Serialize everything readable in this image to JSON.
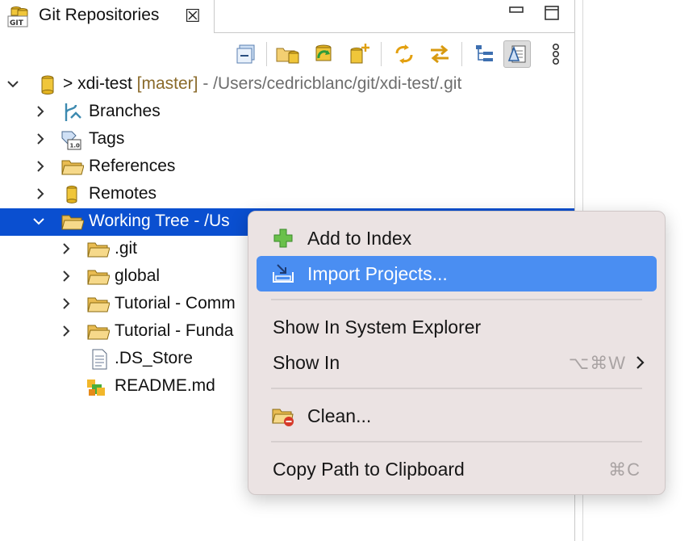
{
  "view": {
    "tab_title": "Git Repositories",
    "tab_icon": "git-repositories-icon",
    "close_glyph": "☒"
  },
  "toolbar": {
    "buttons": [
      "collapse-all",
      "add-existing-repository",
      "clone-repository",
      "create-repository",
      "link-with-selection",
      "synchronize",
      "hierarchical-layout",
      "show-details",
      "view-menu"
    ]
  },
  "tree": {
    "repo": {
      "name": "xdi-test",
      "prefix": ">",
      "branch": "[master]",
      "path": "- /Users/cedricblanc/git/xdi-test/.git"
    },
    "groups": [
      "Branches",
      "Tags",
      "References",
      "Remotes"
    ],
    "working_tree": "Working Tree - /Us",
    "children": [
      ".git",
      "global",
      "Tutorial - Comm",
      "Tutorial - Funda",
      ".DS_Store",
      "README.md"
    ]
  },
  "context_menu": {
    "items": {
      "add_to_index": "Add to Index",
      "import_projects": "Import Projects...",
      "show_in_system_explorer": "Show In System Explorer",
      "show_in": "Show In",
      "show_in_shortcut": "⌥⌘W",
      "clean": "Clean...",
      "copy_path": "Copy Path to Clipboard",
      "copy_path_shortcut": "⌘C"
    },
    "highlighted": "Import Projects..."
  },
  "colors": {
    "selection": "#0a4fd0",
    "menu_highlight": "#4a8ef2",
    "menu_background": "#ebe3e3",
    "branch_text": "#8a6a2a"
  }
}
